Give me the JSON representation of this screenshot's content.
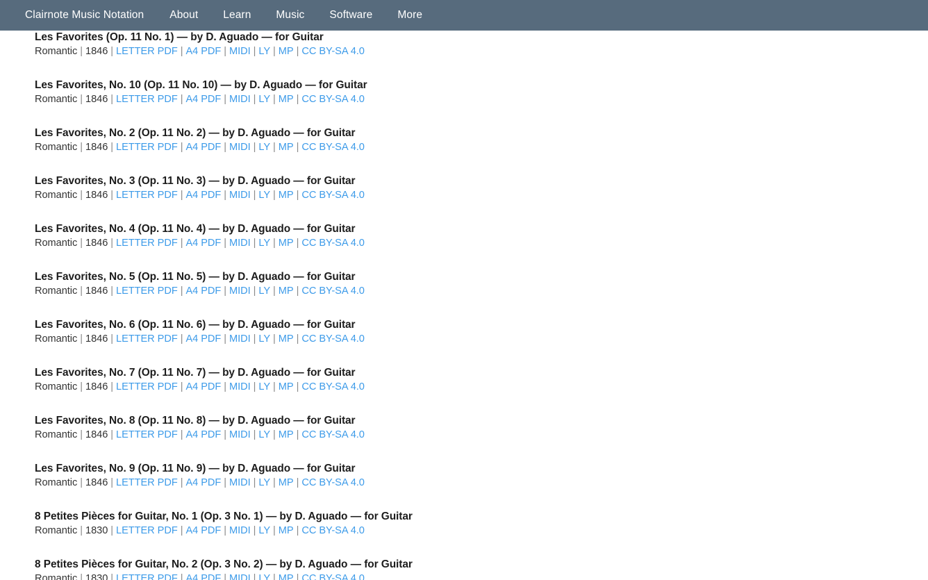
{
  "nav": {
    "brand": "Clairnote Music Notation",
    "items": [
      {
        "label": "About"
      },
      {
        "label": "Learn"
      },
      {
        "label": "Music"
      },
      {
        "label": "Software"
      },
      {
        "label": "More"
      }
    ]
  },
  "colors": {
    "nav_background": "#576b7d",
    "nav_text": "#ffffff",
    "link": "#3d9be9",
    "title_text": "#1c1c1c",
    "meta_text": "#333333",
    "separator": "#8a8a8a",
    "page_background": "#ffffff"
  },
  "meta_labels": {
    "separator": "|",
    "letter_pdf": "LETTER PDF",
    "a4_pdf": "A4 PDF",
    "midi": "MIDI",
    "ly": "LY",
    "mp": "MP",
    "license": "CC BY-SA 4.0"
  },
  "scores": [
    {
      "title": "Les Favorites (Op. 11 No. 1) — by D. Aguado — for Guitar",
      "period": "Romantic",
      "year": "1846",
      "letter_pdf": "LETTER PDF",
      "a4_pdf": "A4 PDF",
      "midi": "MIDI",
      "ly": "LY",
      "mp": "MP",
      "license": "CC BY-SA 4.0"
    },
    {
      "title": "Les Favorites, No. 10 (Op. 11 No. 10) — by D. Aguado — for Guitar",
      "period": "Romantic",
      "year": "1846",
      "letter_pdf": "LETTER PDF",
      "a4_pdf": "A4 PDF",
      "midi": "MIDI",
      "ly": "LY",
      "mp": "MP",
      "license": "CC BY-SA 4.0"
    },
    {
      "title": "Les Favorites, No. 2 (Op. 11 No. 2) — by D. Aguado — for Guitar",
      "period": "Romantic",
      "year": "1846",
      "letter_pdf": "LETTER PDF",
      "a4_pdf": "A4 PDF",
      "midi": "MIDI",
      "ly": "LY",
      "mp": "MP",
      "license": "CC BY-SA 4.0"
    },
    {
      "title": "Les Favorites, No. 3 (Op. 11 No. 3) — by D. Aguado — for Guitar",
      "period": "Romantic",
      "year": "1846",
      "letter_pdf": "LETTER PDF",
      "a4_pdf": "A4 PDF",
      "midi": "MIDI",
      "ly": "LY",
      "mp": "MP",
      "license": "CC BY-SA 4.0"
    },
    {
      "title": "Les Favorites, No. 4 (Op. 11 No. 4) — by D. Aguado — for Guitar",
      "period": "Romantic",
      "year": "1846",
      "letter_pdf": "LETTER PDF",
      "a4_pdf": "A4 PDF",
      "midi": "MIDI",
      "ly": "LY",
      "mp": "MP",
      "license": "CC BY-SA 4.0"
    },
    {
      "title": "Les Favorites, No. 5 (Op. 11 No. 5) — by D. Aguado — for Guitar",
      "period": "Romantic",
      "year": "1846",
      "letter_pdf": "LETTER PDF",
      "a4_pdf": "A4 PDF",
      "midi": "MIDI",
      "ly": "LY",
      "mp": "MP",
      "license": "CC BY-SA 4.0"
    },
    {
      "title": "Les Favorites, No. 6 (Op. 11 No. 6) — by D. Aguado — for Guitar",
      "period": "Romantic",
      "year": "1846",
      "letter_pdf": "LETTER PDF",
      "a4_pdf": "A4 PDF",
      "midi": "MIDI",
      "ly": "LY",
      "mp": "MP",
      "license": "CC BY-SA 4.0"
    },
    {
      "title": "Les Favorites, No. 7 (Op. 11 No. 7) — by D. Aguado — for Guitar",
      "period": "Romantic",
      "year": "1846",
      "letter_pdf": "LETTER PDF",
      "a4_pdf": "A4 PDF",
      "midi": "MIDI",
      "ly": "LY",
      "mp": "MP",
      "license": "CC BY-SA 4.0"
    },
    {
      "title": "Les Favorites, No. 8 (Op. 11 No. 8) — by D. Aguado — for Guitar",
      "period": "Romantic",
      "year": "1846",
      "letter_pdf": "LETTER PDF",
      "a4_pdf": "A4 PDF",
      "midi": "MIDI",
      "ly": "LY",
      "mp": "MP",
      "license": "CC BY-SA 4.0"
    },
    {
      "title": "Les Favorites, No. 9 (Op. 11 No. 9) — by D. Aguado — for Guitar",
      "period": "Romantic",
      "year": "1846",
      "letter_pdf": "LETTER PDF",
      "a4_pdf": "A4 PDF",
      "midi": "MIDI",
      "ly": "LY",
      "mp": "MP",
      "license": "CC BY-SA 4.0"
    },
    {
      "title": "8 Petites Pièces for Guitar, No. 1 (Op. 3 No. 1) — by D. Aguado — for Guitar",
      "period": "Romantic",
      "year": "1830",
      "letter_pdf": "LETTER PDF",
      "a4_pdf": "A4 PDF",
      "midi": "MIDI",
      "ly": "LY",
      "mp": "MP",
      "license": "CC BY-SA 4.0"
    },
    {
      "title": "8 Petites Pièces for Guitar, No. 2 (Op. 3 No. 2) — by D. Aguado — for Guitar",
      "period": "Romantic",
      "year": "1830",
      "letter_pdf": "LETTER PDF",
      "a4_pdf": "A4 PDF",
      "midi": "MIDI",
      "ly": "LY",
      "mp": "MP",
      "license": "CC BY-SA 4.0"
    }
  ]
}
